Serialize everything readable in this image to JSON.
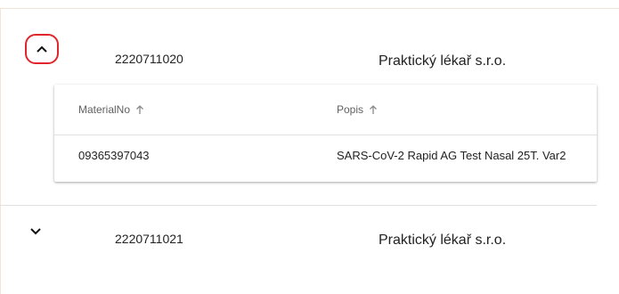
{
  "rows": [
    {
      "id": "2220711020",
      "name": "Praktický lékař s.r.o.",
      "expanded": true,
      "toggle_icon": "chevron-up-icon"
    },
    {
      "id": "2220711021",
      "name": "Praktický lékař s.r.o.",
      "expanded": false,
      "toggle_icon": "chevron-down-icon"
    }
  ],
  "detail_table": {
    "columns": [
      {
        "label": "MaterialNo",
        "sort_icon": "arrow-up-icon"
      },
      {
        "label": "Popis",
        "sort_icon": "arrow-up-icon"
      }
    ],
    "rows": [
      {
        "material_no": "09365397043",
        "popis": "SARS-CoV-2 Rapid AG Test Nasal 25T. Var2"
      }
    ]
  },
  "colors": {
    "highlight": "#e0262a",
    "divider": "#e0e0e0",
    "frame": "#f6e3d8"
  }
}
